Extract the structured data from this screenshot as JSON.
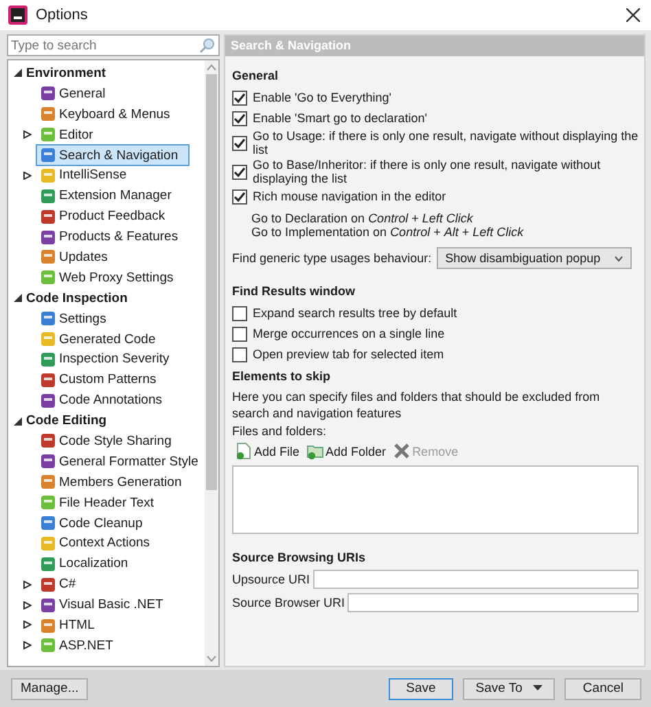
{
  "window": {
    "title": "Options"
  },
  "search": {
    "placeholder": "Type to search"
  },
  "tree": [
    {
      "label": "Environment",
      "expanded": true,
      "children": [
        {
          "label": "General",
          "selected": false
        },
        {
          "label": "Keyboard & Menus",
          "selected": false
        },
        {
          "label": "Editor",
          "selected": false,
          "expanded": false
        },
        {
          "label": "Search & Navigation",
          "selected": true
        },
        {
          "label": "IntelliSense",
          "selected": false,
          "expanded": false
        },
        {
          "label": "Extension Manager",
          "selected": false
        },
        {
          "label": "Product Feedback",
          "selected": false
        },
        {
          "label": "Products & Features",
          "selected": false
        },
        {
          "label": "Updates",
          "selected": false
        },
        {
          "label": "Web Proxy Settings",
          "selected": false
        }
      ]
    },
    {
      "label": "Code Inspection",
      "expanded": true,
      "children": [
        {
          "label": "Settings",
          "selected": false
        },
        {
          "label": "Generated Code",
          "selected": false
        },
        {
          "label": "Inspection Severity",
          "selected": false
        },
        {
          "label": "Custom Patterns",
          "selected": false
        },
        {
          "label": "Code Annotations",
          "selected": false
        }
      ]
    },
    {
      "label": "Code Editing",
      "expanded": true,
      "children": [
        {
          "label": "Code Style Sharing",
          "selected": false
        },
        {
          "label": "General Formatter Style",
          "selected": false
        },
        {
          "label": "Members Generation",
          "selected": false
        },
        {
          "label": "File Header Text",
          "selected": false
        },
        {
          "label": "Code Cleanup",
          "selected": false
        },
        {
          "label": "Context Actions",
          "selected": false
        },
        {
          "label": "Localization",
          "selected": false
        },
        {
          "label": "C#",
          "selected": false,
          "expanded": false
        },
        {
          "label": "Visual Basic .NET",
          "selected": false,
          "expanded": false
        },
        {
          "label": "HTML",
          "selected": false,
          "expanded": false
        },
        {
          "label": "ASP.NET",
          "selected": false,
          "expanded": false
        }
      ]
    }
  ],
  "panel": {
    "header": "Search & Navigation",
    "general": {
      "heading": "General",
      "options": [
        {
          "label": "Enable 'Go to Everything'",
          "checked": true
        },
        {
          "label": "Enable 'Smart go to declaration'",
          "checked": true
        },
        {
          "label": "Go to Usage: if there is only one result, navigate without displaying the list",
          "checked": true
        },
        {
          "label": "Go to Base/Inheritor: if there is only one result, navigate without displaying the list",
          "checked": true
        },
        {
          "label": "Rich mouse navigation in the editor",
          "checked": true
        }
      ],
      "notes": [
        "Go to Declaration on *Control* + *Left Click*",
        "Go to Implementation on *Control* + *Alt* + *Left Click*"
      ],
      "generic_usages": {
        "label": "Find generic type usages behaviour:",
        "value": "Show disambiguation popup"
      }
    },
    "find_results": {
      "heading": "Find Results window",
      "options": [
        {
          "label": "Expand search results tree by default",
          "checked": false
        },
        {
          "label": "Merge occurrences on a single line",
          "checked": false
        },
        {
          "label": "Open preview tab for selected item",
          "checked": false
        }
      ]
    },
    "skip": {
      "heading": "Elements to skip",
      "description": "Here you can specify files and folders that should be excluded from search and navigation features",
      "list_label": "Files and folders:",
      "toolbar": [
        {
          "kind": "add-file",
          "label": "Add File",
          "disabled": false
        },
        {
          "kind": "add-folder",
          "label": "Add Folder",
          "disabled": false
        },
        {
          "kind": "remove",
          "label": "Remove",
          "disabled": true
        }
      ]
    },
    "uris": {
      "heading": "Source Browsing URIs",
      "fields": [
        {
          "label": "Upsource URI"
        },
        {
          "label": "Source Browser URI"
        }
      ]
    }
  },
  "footer": {
    "manage": "Manage...",
    "buttons": [
      {
        "kind": "plain",
        "label": "Save",
        "default": true
      },
      {
        "kind": "split",
        "label": "Save To",
        "default": false
      },
      {
        "kind": "plain",
        "label": "Cancel",
        "default": false
      }
    ]
  }
}
